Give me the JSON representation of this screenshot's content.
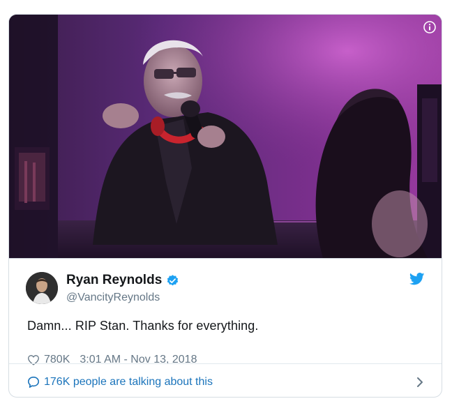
{
  "tweet": {
    "author": {
      "name": "Ryan Reynolds",
      "handle": "@VancityReynolds",
      "verified": true
    },
    "text": "Damn... RIP Stan. Thanks for everything.",
    "likes": "780K",
    "timestamp": "3:01 AM - Nov 13, 2018",
    "talking": "176K people are talking about this"
  },
  "icons": {
    "info": "info-icon",
    "verified": "verified-badge-icon",
    "brand": "twitter-bird-icon",
    "like": "heart-icon",
    "reply": "speech-bubble-icon",
    "more": "chevron-right-icon"
  },
  "colors": {
    "brand": "#1da1f2",
    "link": "#1b74bb",
    "secondary_text": "#657786",
    "primary_text": "#14171a",
    "border": "#d6dde3"
  }
}
